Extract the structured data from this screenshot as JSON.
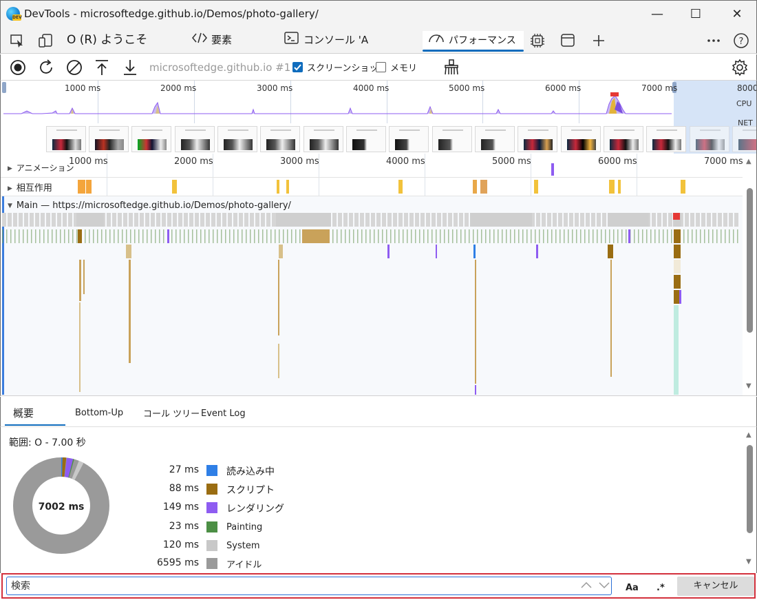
{
  "window": {
    "title": "DevTools - microsoftedge.github.io/Demos/photo-gallery/",
    "minimize": "—",
    "maximize": "☐",
    "close": "✕"
  },
  "tabs": [
    {
      "label": "O (R) ようこそ"
    },
    {
      "label": "要素"
    },
    {
      "label": "コンソール 'A"
    },
    {
      "label": "パフォーマンス"
    }
  ],
  "toolbar": {
    "target": "microsoftedge.github.io #1",
    "screenshots_label": "スクリーンショット",
    "screenshots_checked": true,
    "memory_label": "メモリ",
    "memory_checked": false
  },
  "overview": {
    "ticks": [
      "1000 ms",
      "2000 ms",
      "3000 ms",
      "4000 ms",
      "5000 ms",
      "6000 ms",
      "7000 ms",
      "8000"
    ],
    "cpu_label": "CPU",
    "net_label": "NET"
  },
  "flame": {
    "ticks": [
      "1000 ms",
      "2000 ms",
      "3000 ms",
      "4000 ms",
      "5000 ms",
      "6000 ms",
      "7000 ms"
    ],
    "tracks": {
      "animation": "アニメーション",
      "interactions": "相互作用",
      "main": "Main — https://microsoftedge.github.io/Demos/photo-gallery/"
    }
  },
  "bottom": {
    "tabs": [
      "概要",
      "Bottom-Up",
      "コール ツリー",
      "Event Log"
    ],
    "range": "範囲: O - 7.00 秒",
    "total": "7002 ms",
    "legend": [
      {
        "ms": "27 ms",
        "name": "読み込み中",
        "color": "#2f7fe6"
      },
      {
        "ms": "88 ms",
        "name": "スクリプト",
        "color": "#9a6d12"
      },
      {
        "ms": "149 ms",
        "name": "レンダリング",
        "color": "#8e5cf1"
      },
      {
        "ms": "23 ms",
        "name": "Painting",
        "color": "#4c8f45"
      },
      {
        "ms": "120 ms",
        "name": "System",
        "color": "#c8c8c8"
      },
      {
        "ms": "6595 ms",
        "name": "アイドル",
        "color": "#9a9a9a"
      }
    ]
  },
  "search": {
    "placeholder": "検索",
    "match_case": "Aa",
    "regex": ".*",
    "cancel": "キャンセル"
  }
}
